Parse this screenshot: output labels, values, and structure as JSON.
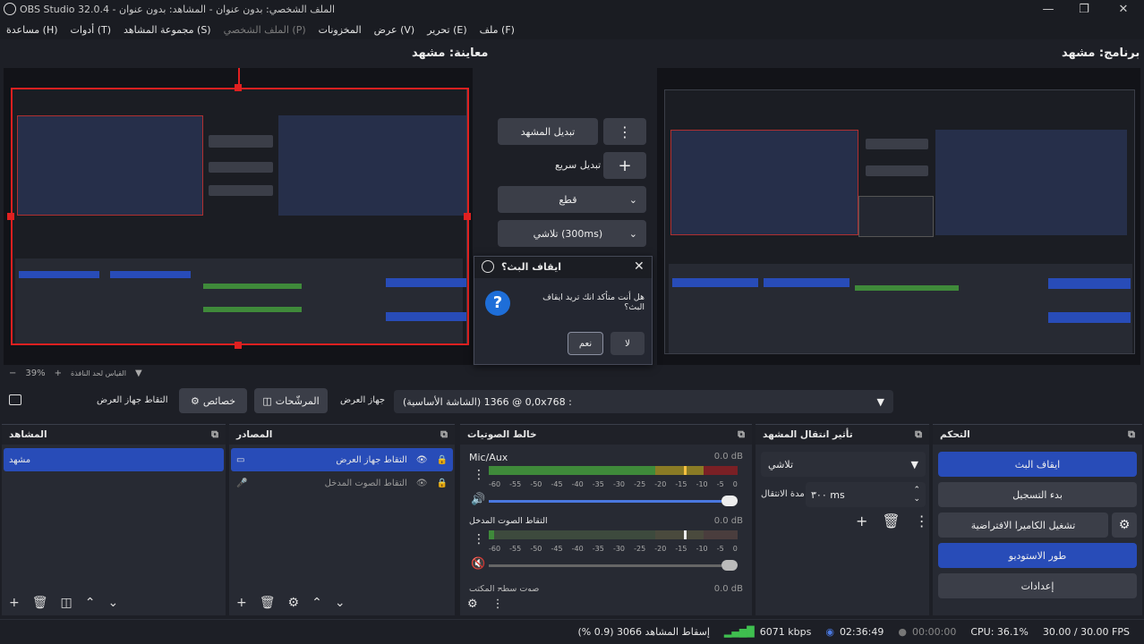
{
  "window": {
    "title": "OBS Studio 32.0.4 - الملف الشخصي: بدون عنوان - المشاهد: بدون عنوان"
  },
  "menu": [
    {
      "label": "ملف (F)",
      "dim": false
    },
    {
      "label": "تحرير (E)",
      "dim": false
    },
    {
      "label": "عرض (V)",
      "dim": false
    },
    {
      "label": "المخزونات",
      "dim": false
    },
    {
      "label": "الملف الشخصي (P)",
      "dim": true
    },
    {
      "label": "مجموعة المشاهد (S)",
      "dim": false
    },
    {
      "label": "أدوات (T)",
      "dim": false
    },
    {
      "label": "مساعدة (H)",
      "dim": false
    }
  ],
  "preview": {
    "label": "معاينة: مشهد",
    "zoom": "39%",
    "scale_label": "القياس لحد النافذة"
  },
  "program": {
    "label": "برنامج: مشهد"
  },
  "transition_controls": {
    "swap": "تبديل المشهد",
    "quick": "تبديل سريع",
    "cut": "قطع",
    "fade": "تلاشي (300ms)"
  },
  "dialog": {
    "title": "ايقاف البث؟",
    "message": "هل أنت متأكد انك تريد ايقاف البث؟",
    "yes": "نعم",
    "no": "لا"
  },
  "source_bar": {
    "selected_source": "التقاط جهاز العرض",
    "properties": "خصائص",
    "filters": "المرشّحات",
    "device_label": "جهاز العرض",
    "device_value": "(الشاشة الأساسية) 0,0 @ 1366x768 :"
  },
  "docks": {
    "scenes": {
      "title": "المشاهد",
      "items": [
        "مشهد"
      ]
    },
    "sources": {
      "title": "المصادر",
      "items": [
        "التقاط جهاز العرض",
        "التقاط الصوت المدخل"
      ]
    },
    "mixer": {
      "title": "خالط الصوتيات",
      "channels": [
        {
          "name": "Mic/Aux",
          "db": "0.0 dB"
        },
        {
          "name": "التقاط الصوت المدخل",
          "db": "0.0 dB"
        },
        {
          "name": "صوت سطح المكتب",
          "db": "0.0 dB"
        }
      ],
      "scale": [
        "-60",
        "-55",
        "-50",
        "-45",
        "-40",
        "-35",
        "-30",
        "-25",
        "-20",
        "-15",
        "-10",
        "-5",
        "0"
      ]
    },
    "transitions": {
      "title": "تأثير انتقال المشهد",
      "type": "تلاشي",
      "duration_label": "مدة الانتقال",
      "duration": "٣٠٠ ms"
    },
    "controls": {
      "title": "التحكم",
      "stop_stream": "ايقاف البث",
      "start_recording": "بدء التسجيل",
      "virtual_cam": "تشغيل الكاميرا الافتراضية",
      "studio_mode": "طور الاستوديو",
      "settings": "إعدادات"
    }
  },
  "status": {
    "dropped": "إسقاط المشاهد 3066 (0.9 %)",
    "bitrate": "6071 kbps",
    "stream_time": "02:36:49",
    "rec_time": "00:00:00",
    "cpu": "CPU: 36.1%",
    "fps": "30.00 / 30.00 FPS"
  },
  "colors": {
    "accent": "#284cb8",
    "selection_red": "#e02020"
  }
}
